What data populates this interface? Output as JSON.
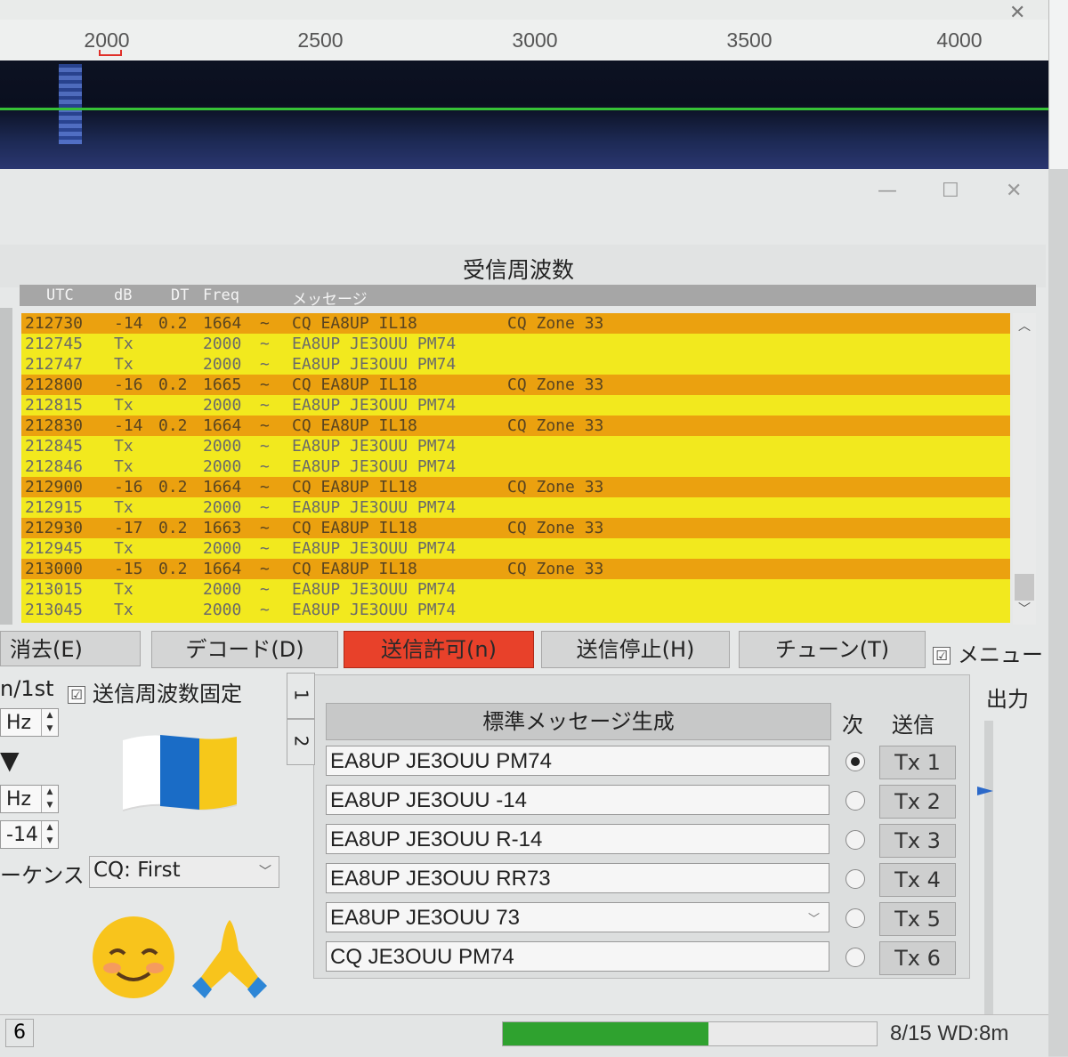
{
  "waterfall": {
    "ticks": [
      "2000",
      "2500",
      "3000",
      "3500",
      "4000"
    ]
  },
  "decode_panel": {
    "title": "受信周波数",
    "headers": {
      "utc": "UTC",
      "db": "dB",
      "dt": "DT",
      "freq": "Freq",
      "message": "メッセージ"
    },
    "rows": [
      {
        "utc": "212730",
        "db": "-14",
        "dt": "0.2",
        "freq": "1664",
        "sep": "~",
        "msg": "CQ EA8UP IL18",
        "extra": "CQ Zone 33",
        "type": "cq"
      },
      {
        "utc": "212745",
        "db": "Tx",
        "dt": "",
        "freq": "2000",
        "sep": "~",
        "msg": "EA8UP JE3OUU PM74",
        "extra": "",
        "type": "tx"
      },
      {
        "utc": "212747",
        "db": "Tx",
        "dt": "",
        "freq": "2000",
        "sep": "~",
        "msg": "EA8UP JE3OUU PM74",
        "extra": "",
        "type": "tx"
      },
      {
        "utc": "212800",
        "db": "-16",
        "dt": "0.2",
        "freq": "1665",
        "sep": "~",
        "msg": "CQ EA8UP IL18",
        "extra": "CQ Zone 33",
        "type": "cq"
      },
      {
        "utc": "212815",
        "db": "Tx",
        "dt": "",
        "freq": "2000",
        "sep": "~",
        "msg": "EA8UP JE3OUU PM74",
        "extra": "",
        "type": "tx"
      },
      {
        "utc": "212830",
        "db": "-14",
        "dt": "0.2",
        "freq": "1664",
        "sep": "~",
        "msg": "CQ EA8UP IL18",
        "extra": "CQ Zone 33",
        "type": "cq"
      },
      {
        "utc": "212845",
        "db": "Tx",
        "dt": "",
        "freq": "2000",
        "sep": "~",
        "msg": "EA8UP JE3OUU PM74",
        "extra": "",
        "type": "tx"
      },
      {
        "utc": "212846",
        "db": "Tx",
        "dt": "",
        "freq": "2000",
        "sep": "~",
        "msg": "EA8UP JE3OUU PM74",
        "extra": "",
        "type": "tx"
      },
      {
        "utc": "212900",
        "db": "-16",
        "dt": "0.2",
        "freq": "1664",
        "sep": "~",
        "msg": "CQ EA8UP IL18",
        "extra": "CQ Zone 33",
        "type": "cq"
      },
      {
        "utc": "212915",
        "db": "Tx",
        "dt": "",
        "freq": "2000",
        "sep": "~",
        "msg": "EA8UP JE3OUU PM74",
        "extra": "",
        "type": "tx"
      },
      {
        "utc": "212930",
        "db": "-17",
        "dt": "0.2",
        "freq": "1663",
        "sep": "~",
        "msg": "CQ EA8UP IL18",
        "extra": "CQ Zone 33",
        "type": "cq"
      },
      {
        "utc": "212945",
        "db": "Tx",
        "dt": "",
        "freq": "2000",
        "sep": "~",
        "msg": "EA8UP JE3OUU PM74",
        "extra": "",
        "type": "tx"
      },
      {
        "utc": "213000",
        "db": "-15",
        "dt": "0.2",
        "freq": "1664",
        "sep": "~",
        "msg": "CQ EA8UP IL18",
        "extra": "CQ Zone 33",
        "type": "cq"
      },
      {
        "utc": "213015",
        "db": "Tx",
        "dt": "",
        "freq": "2000",
        "sep": "~",
        "msg": "EA8UP JE3OUU PM74",
        "extra": "",
        "type": "tx"
      },
      {
        "utc": "213045",
        "db": "Tx",
        "dt": "",
        "freq": "2000",
        "sep": "~",
        "msg": "EA8UP JE3OUU PM74",
        "extra": "",
        "type": "tx"
      }
    ]
  },
  "buttons": {
    "erase": "消去(E)",
    "decode": "デコード(D)",
    "tx_enable": "送信許可(n)",
    "tx_stop": "送信停止(H)",
    "tune": "チューン(T)",
    "menu": "メニュー",
    "menu_checked": "☑"
  },
  "left_controls": {
    "tx_first_label": "n/1st",
    "hold_tx_freq": "送信周波数固定",
    "hold_checked": "☑",
    "hz1": "Hz",
    "hz2": "Hz",
    "report_value": "-14",
    "down_arrow": "▼",
    "sequence_label": "ーケンス",
    "sequence_value": "CQ: First"
  },
  "emoji": {
    "flag_colors": [
      "#ffffff",
      "#1a6cc6",
      "#f6c81a"
    ]
  },
  "tabs": {
    "tab1": "1",
    "tab2": "2"
  },
  "generator": {
    "header": "標準メッセージ生成",
    "next_label": "次",
    "send_label": "送信",
    "messages": [
      {
        "text": "EA8UP JE3OUU PM74",
        "tx": "Tx 1",
        "selected": true
      },
      {
        "text": "EA8UP JE3OUU -14",
        "tx": "Tx 2",
        "selected": false
      },
      {
        "text": "EA8UP JE3OUU R-14",
        "tx": "Tx 3",
        "selected": false
      },
      {
        "text": "EA8UP JE3OUU RR73",
        "tx": "Tx 4",
        "selected": false
      },
      {
        "text": "EA8UP JE3OUU 73",
        "tx": "Tx 5",
        "selected": false
      },
      {
        "text": "CQ JE3OUU PM74",
        "tx": "Tx 6",
        "selected": false
      }
    ]
  },
  "power": {
    "label": "出力"
  },
  "status": {
    "left": "6",
    "progress_fraction": 0.55,
    "right": "8/15 WD:8m"
  }
}
